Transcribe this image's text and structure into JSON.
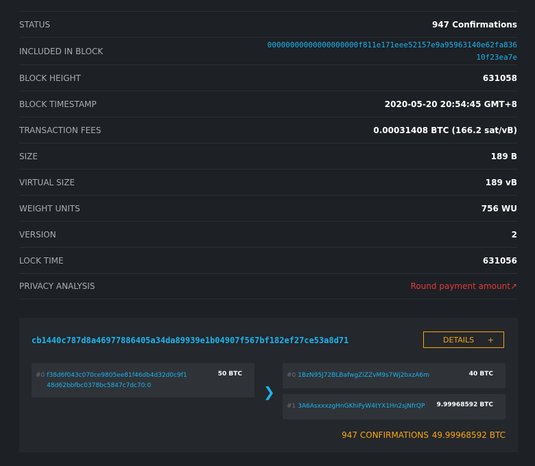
{
  "details": {
    "status": {
      "label": "STATUS",
      "value": "947 Confirmations"
    },
    "included_in_block": {
      "label": "INCLUDED IN BLOCK",
      "value": "00000000000000000000f811e171eee52157e9a95963140e62fa83610f23ea7e"
    },
    "block_height": {
      "label": "BLOCK HEIGHT",
      "value": "631058"
    },
    "block_timestamp": {
      "label": "BLOCK TIMESTAMP",
      "value": "2020-05-20 20:54:45 GMT+8"
    },
    "transaction_fees": {
      "label": "TRANSACTION FEES",
      "value": "0.00031408 BTC (166.2 sat/vB)"
    },
    "size": {
      "label": "SIZE",
      "value": "189 B"
    },
    "virtual_size": {
      "label": "VIRTUAL SIZE",
      "value": "189 vB"
    },
    "weight_units": {
      "label": "WEIGHT UNITS",
      "value": "756 WU"
    },
    "version": {
      "label": "VERSION",
      "value": "2"
    },
    "lock_time": {
      "label": "LOCK TIME",
      "value": "631056"
    },
    "privacy_analysis": {
      "label": "PRIVACY ANALYSIS",
      "value": "Round payment amount"
    }
  },
  "transaction": {
    "txid": "cb1440c787d8a46977886405a34da89939e1b04907f567bf182ef27ce53a8d71",
    "details_label": "DETAILS",
    "details_icon": "+",
    "inputs": [
      {
        "index": "#0",
        "address": "f38d6f043c070ce9805ee81f46db4d32d0c9f148d62bbfbc0378bc5847c7dc70:0",
        "amount": "50 BTC"
      }
    ],
    "arrow_icon": "chevron-right-icon",
    "outputs": [
      {
        "index": "#0",
        "address": "1BzN95J72BLBafwgZiZZvM9s7Wj2bxzA6m",
        "amount": "40 BTC"
      },
      {
        "index": "#1",
        "address": "3A6AsxxxzgHnGKhiFyW4tYX1Hn2sjNfrQP",
        "amount": "9.99968592 BTC"
      }
    ],
    "confirmations": "947 CONFIRMATIONS",
    "total": "49.99968592 BTC"
  },
  "colors": {
    "background": "#1d2024",
    "panel": "#24272b",
    "link": "#1bb4ee",
    "accent": "#f7a80e",
    "alert": "#e23b3b"
  }
}
